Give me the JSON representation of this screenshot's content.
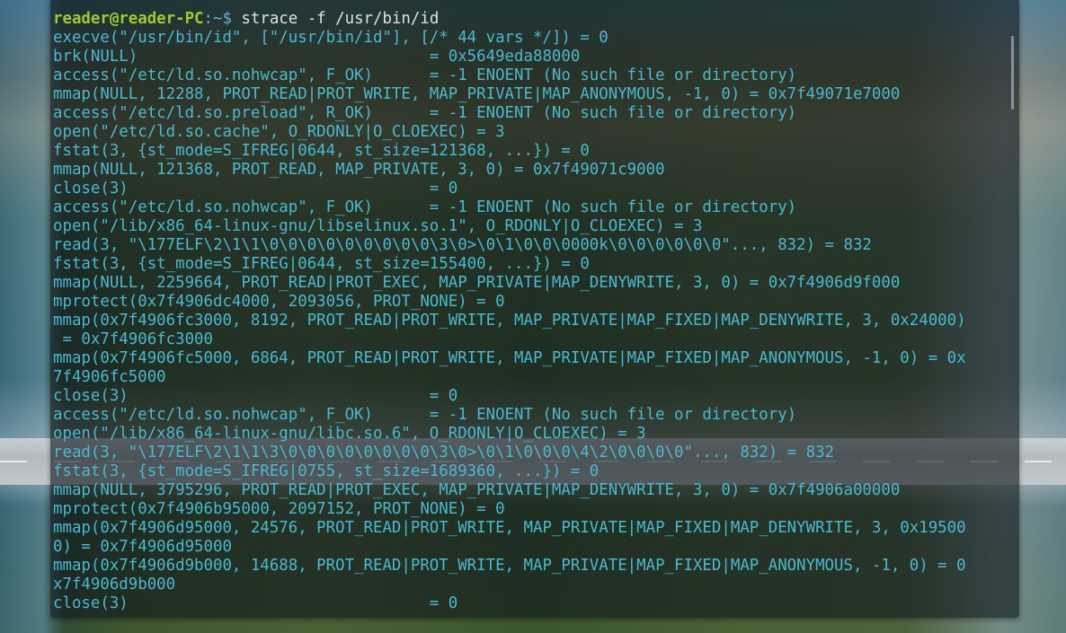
{
  "prompt": {
    "user_host": "reader@reader-PC",
    "path": ":~$",
    "command": " strace -f /usr/bin/id"
  },
  "colors": {
    "output_text": "#4ab8cf",
    "prompt_user": "#9ccc2e",
    "terminal_bg": "rgba(14,22,28,0.62)"
  },
  "output_lines": [
    "execve(\"/usr/bin/id\", [\"/usr/bin/id\"], [/* 44 vars */]) = 0",
    "brk(NULL)                               = 0x5649eda88000",
    "access(\"/etc/ld.so.nohwcap\", F_OK)      = -1 ENOENT (No such file or directory)",
    "mmap(NULL, 12288, PROT_READ|PROT_WRITE, MAP_PRIVATE|MAP_ANONYMOUS, -1, 0) = 0x7f49071e7000",
    "access(\"/etc/ld.so.preload\", R_OK)      = -1 ENOENT (No such file or directory)",
    "open(\"/etc/ld.so.cache\", O_RDONLY|O_CLOEXEC) = 3",
    "fstat(3, {st_mode=S_IFREG|0644, st_size=121368, ...}) = 0",
    "mmap(NULL, 121368, PROT_READ, MAP_PRIVATE, 3, 0) = 0x7f49071c9000",
    "close(3)                                = 0",
    "access(\"/etc/ld.so.nohwcap\", F_OK)      = -1 ENOENT (No such file or directory)",
    "open(\"/lib/x86_64-linux-gnu/libselinux.so.1\", O_RDONLY|O_CLOEXEC) = 3",
    "read(3, \"\\177ELF\\2\\1\\1\\0\\0\\0\\0\\0\\0\\0\\0\\0\\3\\0>\\0\\1\\0\\0\\0000k\\0\\0\\0\\0\\0\\0\"..., 832) = 832",
    "fstat(3, {st_mode=S_IFREG|0644, st_size=155400, ...}) = 0",
    "mmap(NULL, 2259664, PROT_READ|PROT_EXEC, MAP_PRIVATE|MAP_DENYWRITE, 3, 0) = 0x7f4906d9f000",
    "mprotect(0x7f4906dc4000, 2093056, PROT_NONE) = 0",
    "mmap(0x7f4906fc3000, 8192, PROT_READ|PROT_WRITE, MAP_PRIVATE|MAP_FIXED|MAP_DENYWRITE, 3, 0x24000)",
    " = 0x7f4906fc3000",
    "mmap(0x7f4906fc5000, 6864, PROT_READ|PROT_WRITE, MAP_PRIVATE|MAP_FIXED|MAP_ANONYMOUS, -1, 0) = 0x",
    "7f4906fc5000",
    "close(3)                                = 0",
    "access(\"/etc/ld.so.nohwcap\", F_OK)      = -1 ENOENT (No such file or directory)",
    "open(\"/lib/x86_64-linux-gnu/libc.so.6\", O_RDONLY|O_CLOEXEC) = 3",
    "read(3, \"\\177ELF\\2\\1\\1\\3\\0\\0\\0\\0\\0\\0\\0\\0\\3\\0>\\0\\1\\0\\0\\0\\4\\2\\0\\0\\0\\0\"..., 832) = 832",
    "fstat(3, {st_mode=S_IFREG|0755, st_size=1689360, ...}) = 0",
    "mmap(NULL, 3795296, PROT_READ|PROT_EXEC, MAP_PRIVATE|MAP_DENYWRITE, 3, 0) = 0x7f4906a00000",
    "mprotect(0x7f4906b95000, 2097152, PROT_NONE) = 0",
    "mmap(0x7f4906d95000, 24576, PROT_READ|PROT_WRITE, MAP_PRIVATE|MAP_FIXED|MAP_DENYWRITE, 3, 0x19500",
    "0) = 0x7f4906d95000",
    "mmap(0x7f4906d9b000, 14688, PROT_READ|PROT_WRITE, MAP_PRIVATE|MAP_FIXED|MAP_ANONYMOUS, -1, 0) = 0",
    "x7f4906d9b000",
    "close(3)                                = 0"
  ]
}
